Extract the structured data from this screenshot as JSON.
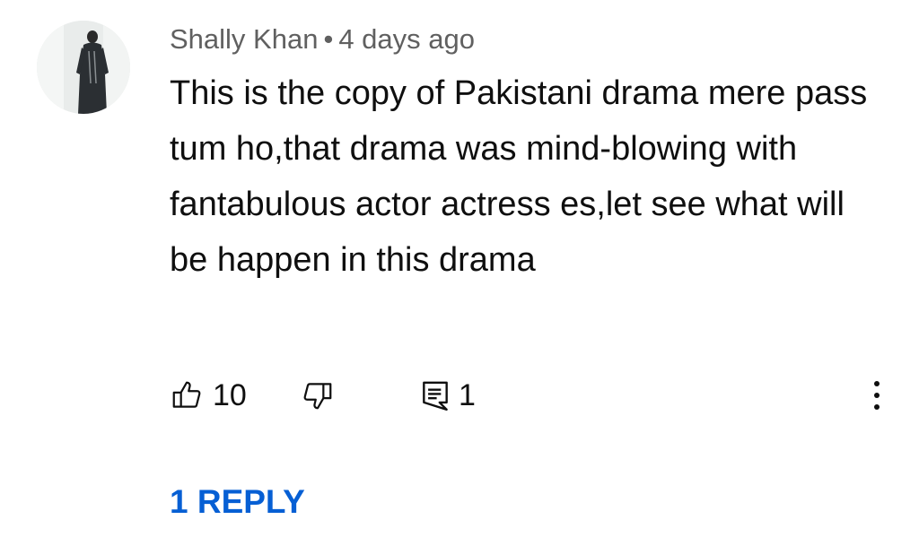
{
  "comment": {
    "author": "Shally Khan",
    "separator": "•",
    "timestamp": "4 days ago",
    "text": "This is the copy of Pakistani drama mere pass tum ho,that drama was mind-blowing with fantabulous actor actress es,let see what will be happen in this drama",
    "like_count": "10",
    "reply_count": "1",
    "replies_link": "1 REPLY"
  },
  "colors": {
    "meta_text": "#606060",
    "body_text": "#0f0f0f",
    "link": "#065fd4"
  },
  "icons": {
    "like": "thumbs-up-icon",
    "dislike": "thumbs-down-icon",
    "reply": "reply-comment-icon",
    "more": "more-vert-icon"
  }
}
